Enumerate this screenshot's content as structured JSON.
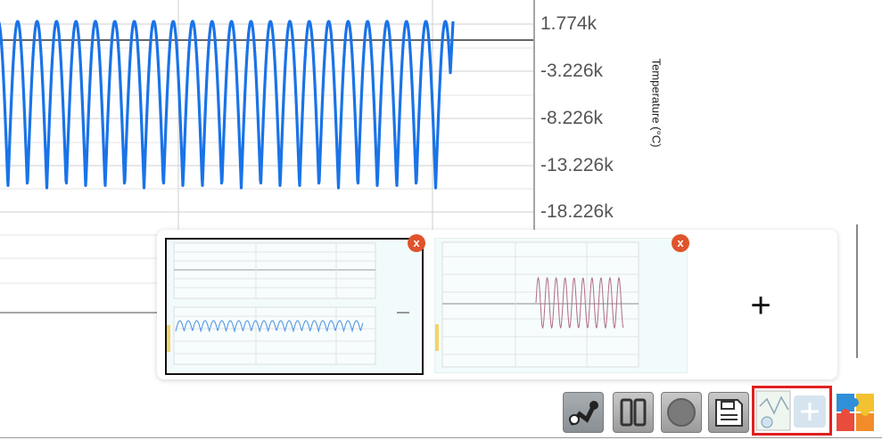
{
  "chart": {
    "ylabel": "Temperature (°C)",
    "yticks": [
      "1.774k",
      "-3.226k",
      "-8.226k",
      "-13.226k",
      "-18.226k"
    ],
    "series_color": "#1a73e8",
    "cycles_visible": 23
  },
  "thumbnails": [
    {
      "close_label": "x",
      "selected": true,
      "series_color": "#4a90e2"
    },
    {
      "close_label": "x",
      "selected": false,
      "series_color": "#b06b8a"
    }
  ],
  "add_label": "+",
  "toolbar": {
    "buttons": [
      "sensor-icon",
      "pause-icon",
      "stop-icon",
      "save-icon",
      "add-graph-icon",
      "puzzle-icon"
    ]
  },
  "colors": {
    "accent_close": "#e0542d",
    "highlight": "#e02020",
    "wave": "#1a73e8"
  }
}
